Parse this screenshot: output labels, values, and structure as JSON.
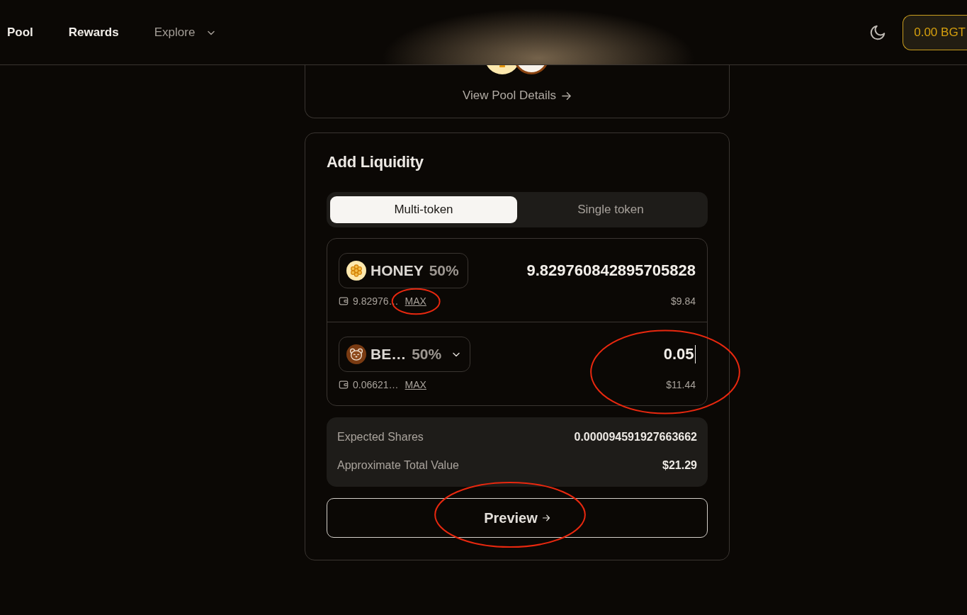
{
  "nav": {
    "links": [
      {
        "label": "Pool",
        "kind": "link"
      },
      {
        "label": "Rewards",
        "kind": "link"
      },
      {
        "label": "Explore",
        "kind": "dropdown"
      }
    ],
    "bgt_balance": "0.00 BGT"
  },
  "pool_card": {
    "details_link": "View Pool Details"
  },
  "add_liquidity": {
    "title": "Add Liquidity",
    "tabs": [
      {
        "label": "Multi-token",
        "selected": true
      },
      {
        "label": "Single token",
        "selected": false
      }
    ],
    "tokens": [
      {
        "kind": "honey",
        "symbol": "HONEY",
        "weight": "50%",
        "amount": "9.829760842895705828",
        "balance": "9.82976…",
        "max_label": "MAX",
        "value": "$9.84",
        "selectable": false,
        "focused": false,
        "max_circled": true,
        "amount_circled": false
      },
      {
        "kind": "bear",
        "symbol": "BE…",
        "weight": "50%",
        "amount": "0.05",
        "balance": "0.06621…",
        "max_label": "MAX",
        "value": "$11.44",
        "selectable": true,
        "focused": true,
        "max_circled": false,
        "amount_circled": true
      }
    ],
    "summary": [
      {
        "label": "Expected Shares",
        "value": "0.000094591927663662"
      },
      {
        "label": "Approximate Total Value",
        "value": "$21.29"
      }
    ],
    "preview_button": {
      "label": "Preview",
      "circled": true
    }
  }
}
